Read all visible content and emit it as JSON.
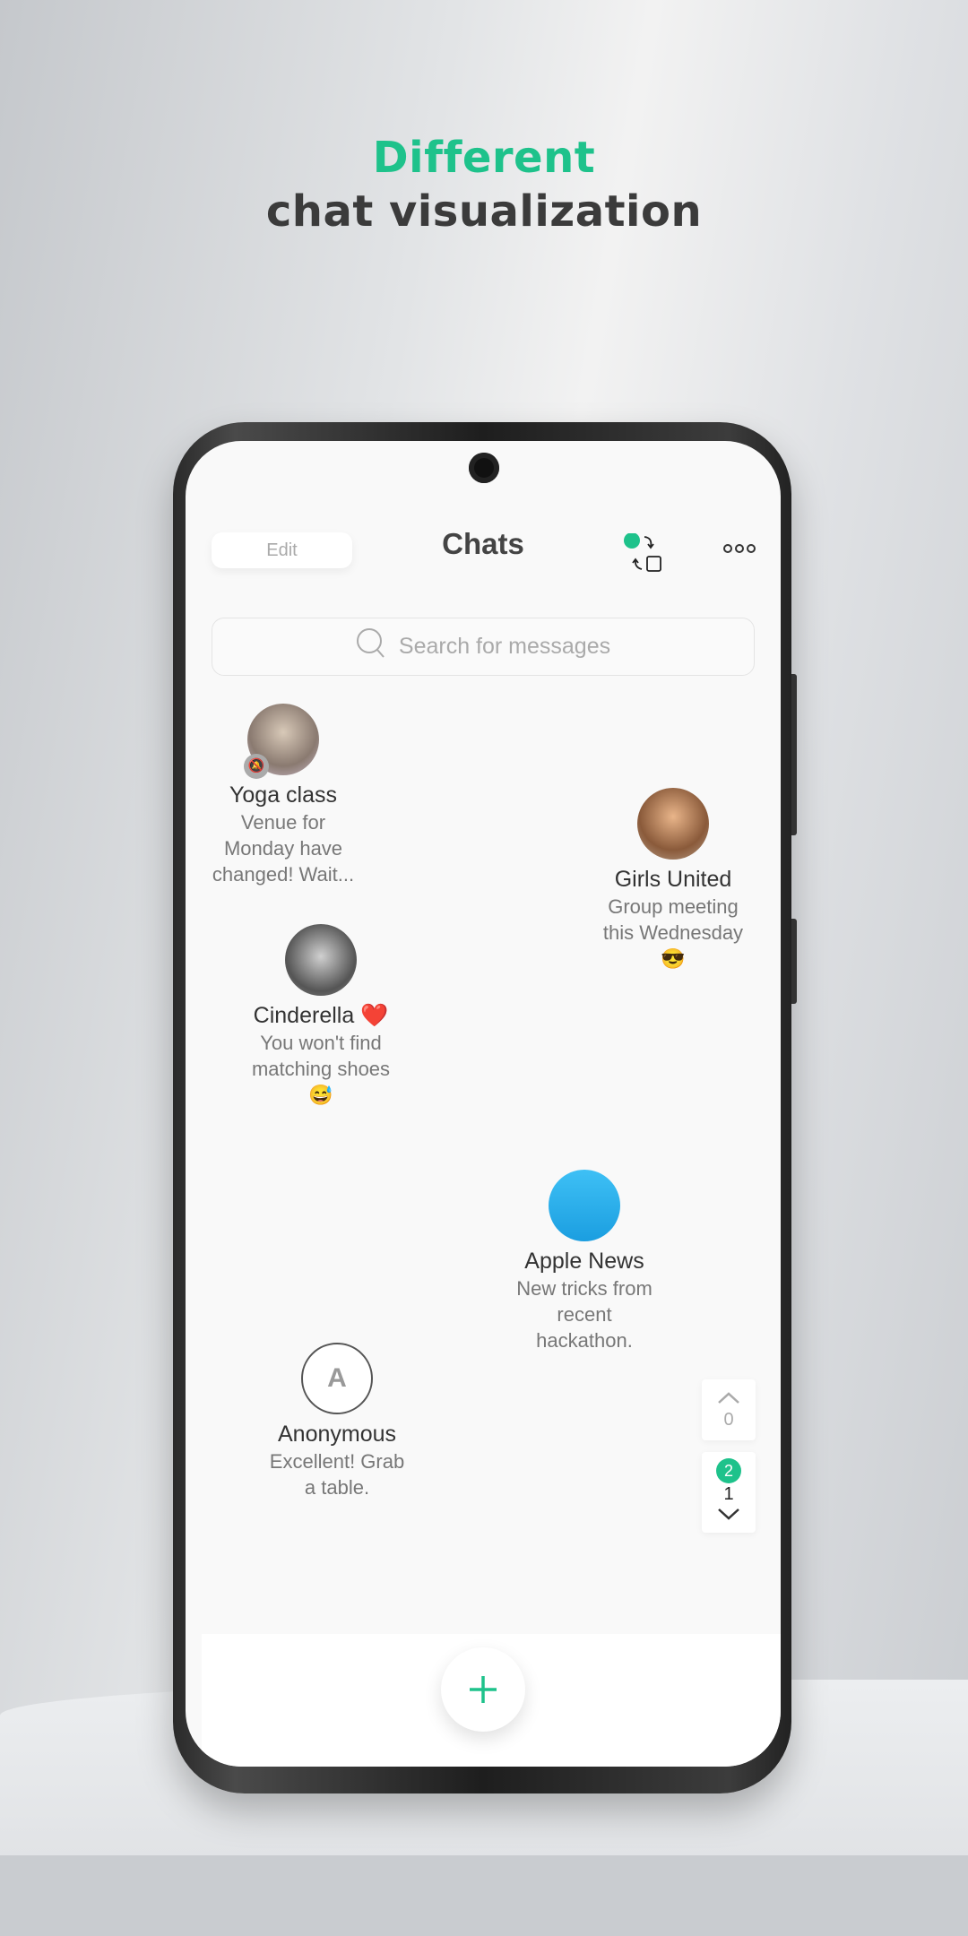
{
  "headline": {
    "line1": "Different",
    "line2": "chat visualization"
  },
  "header": {
    "edit_label": "Edit",
    "title": "Chats",
    "accent": "#1ec28b"
  },
  "search": {
    "placeholder": "Search for messages"
  },
  "chats": [
    {
      "name": "Yoga class",
      "preview": [
        "Venue for",
        "Monday have",
        "changed! Wait..."
      ],
      "muted": true
    },
    {
      "name": "Girls United",
      "preview": [
        "Group meeting",
        "this Wednesday",
        "😎"
      ]
    },
    {
      "name": "Cinderella ❤️",
      "preview": [
        "You won't find",
        "matching shoes",
        "😅"
      ]
    },
    {
      "name": "Apple News",
      "preview": [
        "New tricks from",
        "recent",
        "hackathon."
      ]
    },
    {
      "name": "Anonymous",
      "initial": "A",
      "preview": [
        "Excellent! Grab",
        "a table."
      ]
    }
  ],
  "scroller": {
    "above_count": "0",
    "below_badge": "2",
    "below_count": "1"
  },
  "fab": {
    "icon": "plus-icon"
  }
}
